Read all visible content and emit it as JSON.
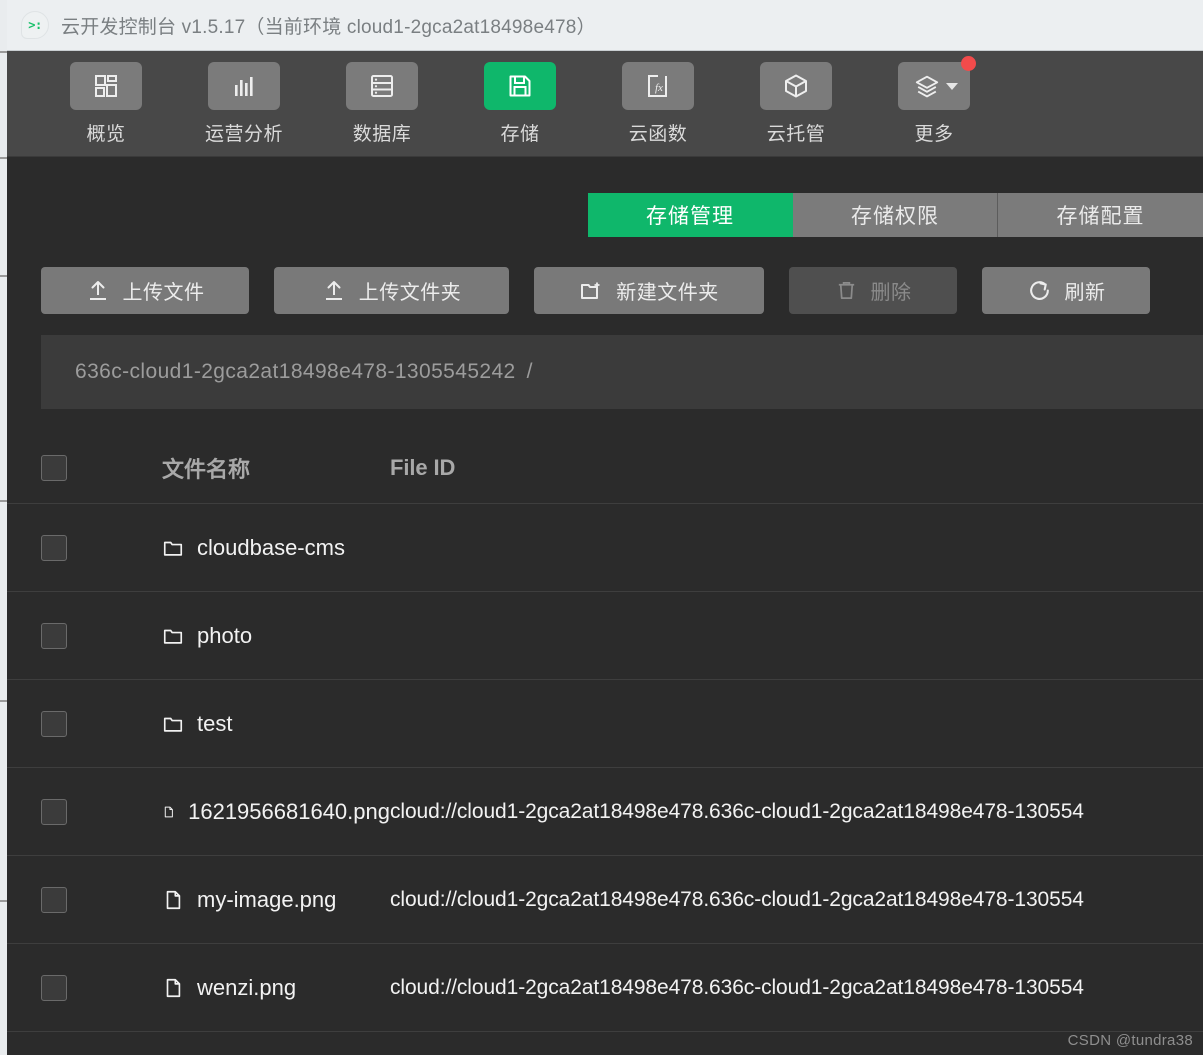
{
  "window": {
    "title": "云开发控制台 v1.5.17（当前环境 cloud1-2gca2at18498e478）",
    "logo_glyph": ">:"
  },
  "navbar": {
    "items": [
      {
        "label": "概览",
        "icon": "grid-icon",
        "active": false,
        "badge": false,
        "caret": false
      },
      {
        "label": "运营分析",
        "icon": "bar-chart-icon",
        "active": false,
        "badge": false,
        "caret": false
      },
      {
        "label": "数据库",
        "icon": "database-icon",
        "active": false,
        "badge": false,
        "caret": false
      },
      {
        "label": "存储",
        "icon": "save-disk-icon",
        "active": true,
        "badge": false,
        "caret": false
      },
      {
        "label": "云函数",
        "icon": "fx-icon",
        "active": false,
        "badge": false,
        "caret": false
      },
      {
        "label": "云托管",
        "icon": "cube-icon",
        "active": false,
        "badge": false,
        "caret": false
      },
      {
        "label": "更多",
        "icon": "layers-icon",
        "active": false,
        "badge": true,
        "caret": true
      }
    ]
  },
  "tabs": [
    {
      "label": "存储管理",
      "active": true
    },
    {
      "label": "存储权限",
      "active": false
    },
    {
      "label": "存储配置",
      "active": false
    }
  ],
  "toolbar": {
    "upload_file": "上传文件",
    "upload_folder": "上传文件夹",
    "new_folder": "新建文件夹",
    "delete": "删除",
    "refresh": "刷新"
  },
  "path": {
    "bucket": "636c-cloud1-2gca2at18498e478-1305545242",
    "separator": "/"
  },
  "table": {
    "headers": {
      "name": "文件名称",
      "file_id": "File ID"
    },
    "rows": [
      {
        "type": "folder",
        "name": "cloudbase-cms",
        "file_id": ""
      },
      {
        "type": "folder",
        "name": "photo",
        "file_id": ""
      },
      {
        "type": "folder",
        "name": "test",
        "file_id": ""
      },
      {
        "type": "file",
        "name": "1621956681640.png",
        "file_id": "cloud://cloud1-2gca2at18498e478.636c-cloud1-2gca2at18498e478-130554"
      },
      {
        "type": "file",
        "name": "my-image.png",
        "file_id": "cloud://cloud1-2gca2at18498e478.636c-cloud1-2gca2at18498e478-130554"
      },
      {
        "type": "file",
        "name": "wenzi.png",
        "file_id": "cloud://cloud1-2gca2at18498e478.636c-cloud1-2gca2at18498e478-130554"
      }
    ]
  },
  "watermark": "CSDN @tundra38",
  "colors": {
    "accent_green": "#0fb76b",
    "badge_red": "#f24b4b",
    "titlebar_bg": "#eceff1",
    "navbar_bg": "#484848",
    "content_bg": "#2b2b2b",
    "button_bg": "#797979"
  }
}
